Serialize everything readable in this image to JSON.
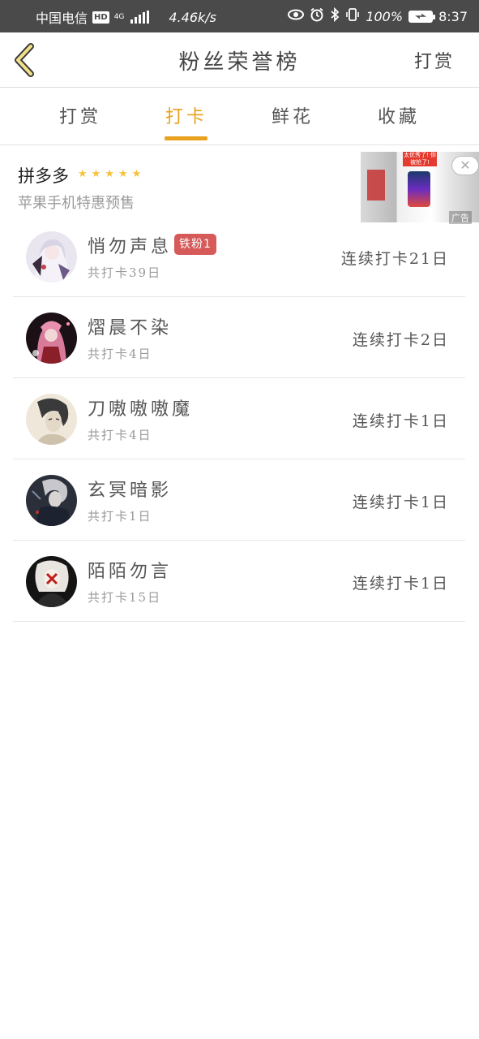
{
  "status_bar": {
    "carrier": "中国电信",
    "hd_label": "HD",
    "network_label": "4G",
    "speed": "4.46k/s",
    "battery": "100%",
    "time": "8:37"
  },
  "header": {
    "title": "粉丝荣誉榜",
    "action_label": "打赏"
  },
  "tabs": [
    {
      "label": "打赏",
      "active": false
    },
    {
      "label": "打卡",
      "active": true
    },
    {
      "label": "鲜花",
      "active": false
    },
    {
      "label": "收藏",
      "active": false
    }
  ],
  "ad": {
    "title": "拼多多",
    "rating_stars": 5,
    "subtitle": "苹果手机特惠预售",
    "ad_label": "广告",
    "image_text": "太优秀了! 你被抢了!"
  },
  "colors": {
    "accent": "#e8a21d",
    "badge": "#d65a5a",
    "star": "#f5c23a",
    "status_bar": "#4a4a4a"
  },
  "fans": [
    {
      "name": "悄勿声息",
      "badge": "铁粉1",
      "total": "共打卡39日",
      "streak": "连续打卡21日",
      "avatar": "avatar-anime-white-hair"
    },
    {
      "name": "熠晨不染",
      "badge": "",
      "total": "共打卡4日",
      "streak": "连续打卡2日",
      "avatar": "avatar-anime-pink-hair"
    },
    {
      "name": "刀嗷嗷嗷魔",
      "badge": "",
      "total": "共打卡4日",
      "streak": "连续打卡1日",
      "avatar": "avatar-sketch-portrait"
    },
    {
      "name": "玄冥暗影",
      "badge": "",
      "total": "共打卡1日",
      "streak": "连续打卡1日",
      "avatar": "avatar-dark-anime"
    },
    {
      "name": "陌陌勿言",
      "badge": "",
      "total": "共打卡15日",
      "streak": "连续打卡1日",
      "avatar": "avatar-masked-figure"
    }
  ]
}
